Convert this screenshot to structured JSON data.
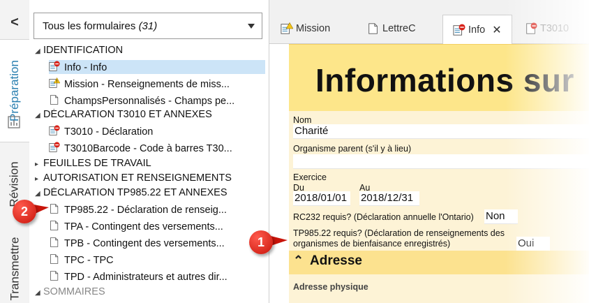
{
  "sidebar": {
    "collapse_glyph": "<",
    "tabs": [
      {
        "label": "Préparation",
        "state": "active"
      },
      {
        "label": "Révision",
        "state": "inactive"
      },
      {
        "label": "Transmettre",
        "state": "inactive"
      }
    ]
  },
  "form_filter": {
    "label": "Tous les formulaires ",
    "count": "(31)"
  },
  "tree": {
    "identification": "IDENTIFICATION",
    "info": "Info - Info",
    "mission": "Mission - Renseignements de miss...",
    "champs": "ChampsPersonnalisés - Champs pe...",
    "t3010_section": "DÉCLARATION T3010 ET ANNEXES",
    "t3010": "T3010 - Déclaration",
    "t3010barcode": "T3010Barcode - Code à barres T30...",
    "feuilles": "FEUILLES DE TRAVAIL",
    "autorisation": "AUTORISATION ET RENSEIGNEMENTS",
    "tp985_section": "DÉCLARATION TP985.22 ET ANNEXES",
    "tp985": "TP985.22 - Déclaration de renseig...",
    "tpa": "TPA - Contingent des versements...",
    "tpb": "TPB - Contingent des versements...",
    "tpc": "TPC - TPC",
    "tpd": "TPD - Administrateurs et autres dir...",
    "sommaires": "SOMMAIRES"
  },
  "callouts": {
    "one": "1",
    "two": "2"
  },
  "doc_tabs": [
    {
      "label": "Mission",
      "icon": "warning-form-icon"
    },
    {
      "label": "LettreC",
      "icon": "form-icon"
    },
    {
      "label": "Info",
      "icon": "error-form-icon",
      "close": "✕"
    },
    {
      "label": "T3010",
      "icon": "error-form-icon"
    }
  ],
  "form": {
    "title": "Informations sur",
    "nom_label": "Nom",
    "nom_value": "Charité",
    "parent_label": "Organisme parent (s'il y à lieu)",
    "exercice_label": "Exercice",
    "du_label": "Du",
    "du_value": "2018/01/01",
    "au_label": "Au",
    "au_value": "2018/12/31",
    "rc232_label": "RC232 requis? (Déclaration annuelle l'Ontario)",
    "rc232_value": "Non",
    "tp985_label_1": "TP985.22 requis? (Déclaration de renseignements des",
    "tp985_label_2": "organismes de bienfaisance enregistrés)",
    "tp985_value": "Oui",
    "adresse_title": "Adresse",
    "adresse_physique": "Adresse physique"
  },
  "colors": {
    "accent": "#2a7fb0",
    "header_yellow": "#fde68a",
    "badge_red": "#d8231a",
    "selected": "#cce4f7"
  }
}
